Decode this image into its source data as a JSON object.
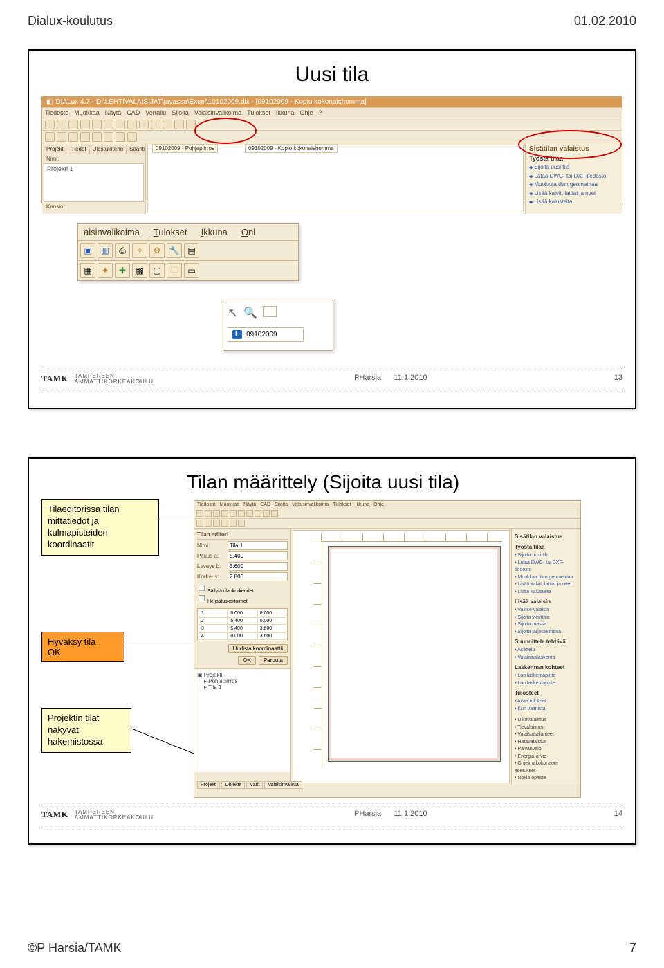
{
  "doc": {
    "header_left": "Dialux-koulutus",
    "header_right": "01.02.2010",
    "footer_left": "©P Harsia/TAMK",
    "footer_right": "7"
  },
  "slide1": {
    "title": "Uusi tila",
    "footer": {
      "author": "PHarsia",
      "date": "11.1.2010",
      "page": "13",
      "org1": "TAMPEREEN",
      "org2": "AMMATTIKORKEAKOULU",
      "logo": "TAMK"
    },
    "win_title": "DIALux 4.7 - D:\\LEHTIVALAISIJAT\\javassa\\Excel\\10102009.dlx - [09102009 - Kopio kokonaishomma]",
    "menu": [
      "Tiedosto",
      "Muokkaa",
      "Näytä",
      "CAD",
      "Vertailu",
      "Sijoita",
      "Valaisinvalikoima",
      "Tulokset",
      "Ikkuna",
      "Ohje",
      "?"
    ],
    "left_tabs": [
      "Projekti",
      "Tiedot",
      "Ulostuloteho",
      "Saanti"
    ],
    "tree_item1": "Projekti 1",
    "tree_item2": "Kansiot",
    "mid_tab1": "09102009 - Pohjapiirros",
    "mid_tab2": "09102009 - Kopio kokonaishomma",
    "right_title": "Sisätilan valaistus",
    "right_sub": "Työstä tilaa",
    "right_items": [
      "Sijoita uusi tila",
      "Lataa DWG- tai DXF-tiedosto",
      "Muokkaa tilan geometriaa",
      "Lisää kalvit, lattiat ja ovet",
      "Lisää kalusteita"
    ],
    "zoom1_menu": [
      "aisinvalikoima",
      "Tulokset",
      "Ikkuna",
      "Onl"
    ],
    "zoom2_text": "09102009"
  },
  "slide2": {
    "title": "Tilan määrittely (Sijoita uusi tila)",
    "callout1": "Tilaeditorissa tilan mittatiedot ja kulmapisteiden koordinaatit",
    "callout2_line1": "Hyväksy tila",
    "callout2_line2": "OK",
    "callout3": "Projektin tilat näkyvät hakemistossa",
    "footer": {
      "author": "PHarsia",
      "date": "11.1.2010",
      "page": "14",
      "org1": "TAMPEREEN",
      "org2": "AMMATTIKORKEAKOULU",
      "logo": "TAMK"
    },
    "editor": {
      "tabs": [
        "Tilan editori"
      ],
      "name_label": "Nimi:",
      "name_value": "Tila 1",
      "len_label": "Pituus a:",
      "len_value": "5.400",
      "wid_label": "Leveys b:",
      "wid_value": "3.600",
      "h_label": "Korkeus:",
      "h_value": "2.800",
      "cb1": "Säilytä tilankorkeudet",
      "cb2": "Heijastuskertoimet",
      "coords": [
        [
          "1",
          "0.000",
          "0.000"
        ],
        [
          "2",
          "5.400",
          "0.000"
        ],
        [
          "3",
          "5.400",
          "3.600"
        ],
        [
          "4",
          "0.000",
          "3.600"
        ]
      ],
      "btn_insert": "Uudista koordinaattii",
      "btn_ok": "OK",
      "btn_cancel": "Peruuta"
    },
    "tree": {
      "root": "Projekti",
      "items": [
        "Pohjapiirros",
        "Tila 1"
      ]
    },
    "tabs_bottom": [
      "Projekti",
      "Objektit",
      "Värit",
      "Valaisinvalinta"
    ],
    "right_panel": {
      "title": "Sisätilan valaistus",
      "g1": "Työstä tilaa",
      "g1_items": [
        "Sijoita uusi tila",
        "Lataa DWG- tai DXF-tiedosto",
        "Muokkaa tilan geometriaa",
        "Lisää kalvit, lattiat ja ovet",
        "Lisää kalusteita"
      ],
      "g2": "Lisää valaisin",
      "g2_items": [
        "Valitse valaisin",
        "Sijoita yksittäin",
        "Sijoita massa",
        "Sijoita järjestelmänä"
      ],
      "g3": "Suunnittele tehtävä",
      "g3_items": [
        "Asettelu",
        "Valaistuslaskenta"
      ],
      "g4": "Laskennan kohteet",
      "g4_items": [
        "Luo laskentapinta",
        "Luo laskentapiste"
      ],
      "g5": "Tulosteet",
      "g5_items": [
        "Avaa tulokset",
        "Kun valmista"
      ],
      "g6_items": [
        "Ulkovalaistus",
        "Tievalaistus",
        "Valaistustilanteet",
        "Hätävalaistus",
        "Päivänvalo",
        "Energia-arvio",
        "Ohjelmakokonaon-asetukset",
        "Nokia opaste"
      ]
    }
  }
}
